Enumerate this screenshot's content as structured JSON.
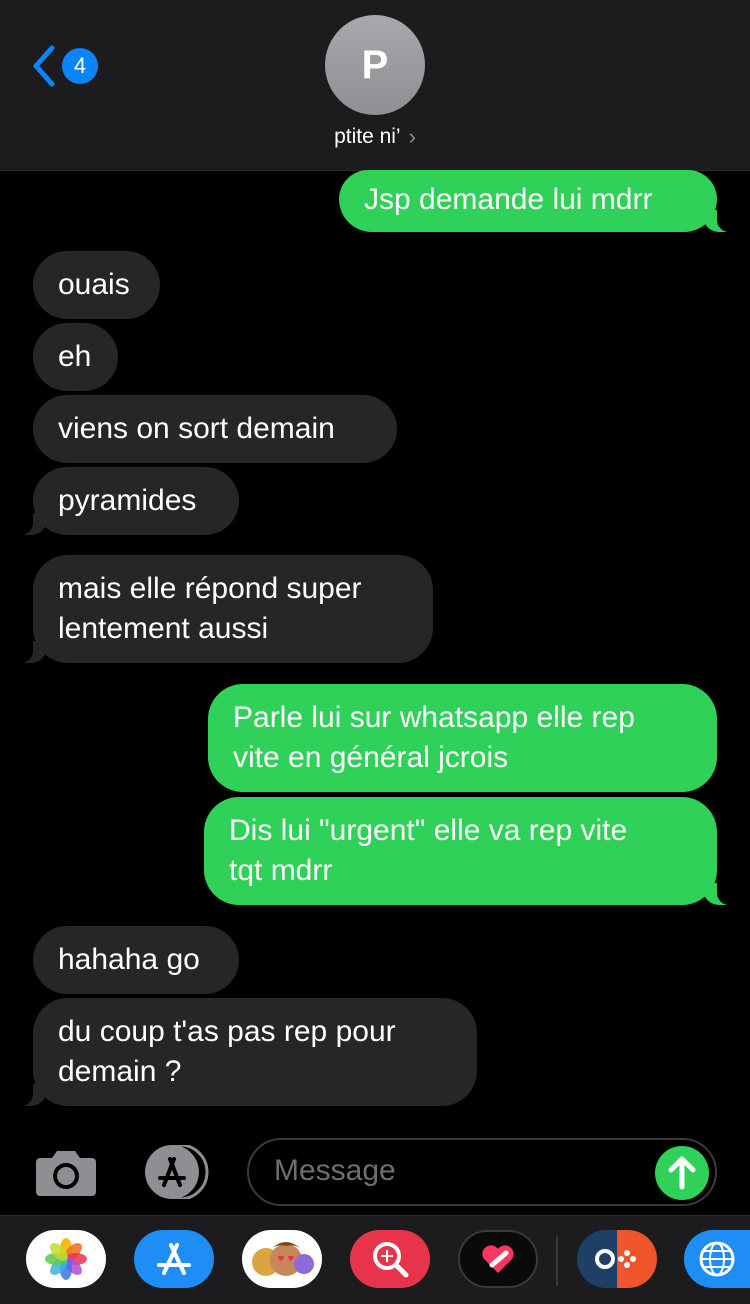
{
  "header": {
    "back_badge": "4",
    "avatar_initial": "P",
    "contact_name": "ptite ni’"
  },
  "messages": [
    {
      "from": "me",
      "text": "Jsp demande lui mdrr"
    },
    {
      "from": "them",
      "text": "ouais"
    },
    {
      "from": "them",
      "text": "eh"
    },
    {
      "from": "them",
      "text": "viens on sort demain"
    },
    {
      "from": "them",
      "text": "pyramides"
    },
    {
      "from": "them",
      "text": "mais elle répond super\nlentement aussi"
    },
    {
      "from": "me",
      "text": "Parle lui sur whatsapp elle rep\nvite en général jcrois"
    },
    {
      "from": "me",
      "text": "Dis lui \"urgent\" elle va rep vite\ntqt mdrr"
    },
    {
      "from": "them",
      "text": "hahaha go"
    },
    {
      "from": "them",
      "text": "du coup t'as pas rep pour\ndemain ?"
    }
  ],
  "composer": {
    "placeholder": "Message"
  },
  "app_drawer": {
    "apps": [
      "photos-icon",
      "app-store-icon",
      "memoji-icon",
      "search-web-icon",
      "digital-touch-icon",
      "game-controller-icon",
      "web-globe-icon"
    ]
  },
  "colors": {
    "sent_bubble": "#30d158",
    "received_bubble": "#262628",
    "accent": "#0a84ff",
    "background": "#000000"
  }
}
